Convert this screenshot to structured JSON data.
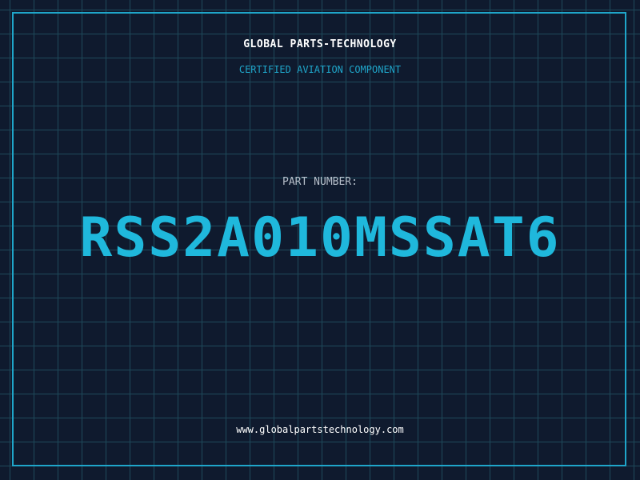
{
  "header": {
    "company": "GLOBAL PARTS-TECHNOLOGY",
    "subtitle": "CERTIFIED AVIATION COMPONENT"
  },
  "part": {
    "label": "PART NUMBER:",
    "number": "RSS2A010MSSAT6"
  },
  "footer": {
    "website": "www.globalpartstechnology.com"
  },
  "colors": {
    "background": "#0f1a2e",
    "grid": "#1e4a5a",
    "accent": "#1fa5c9",
    "part_number": "#1fb8dc"
  }
}
